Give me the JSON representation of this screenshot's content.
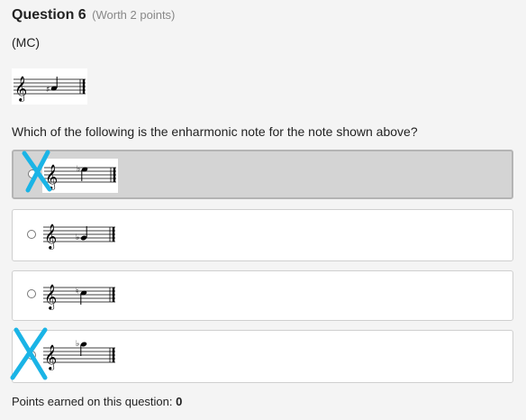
{
  "question": {
    "title": "Question 6",
    "worth": "(Worth 2 points)",
    "type": "(MC)",
    "prompt": "Which of the following is the enharmonic note for the note shown above?",
    "image_icon": "treble-staff-g-sharp-icon"
  },
  "options": [
    {
      "icon": "treble-staff-d-flat-icon",
      "selected": true,
      "crossed_out": true
    },
    {
      "icon": "treble-staff-a-flat-icon",
      "selected": false,
      "crossed_out": false
    },
    {
      "icon": "treble-staff-c-natural-icon",
      "selected": false,
      "crossed_out": false
    },
    {
      "icon": "treble-staff-e-flat-icon",
      "selected": false,
      "crossed_out": true
    }
  ],
  "footer": {
    "points_label": "Points earned on this question: ",
    "points_value": "0"
  },
  "colors": {
    "cross_mark": "#1ab4e6",
    "selected_bg": "#d4d4d4"
  }
}
